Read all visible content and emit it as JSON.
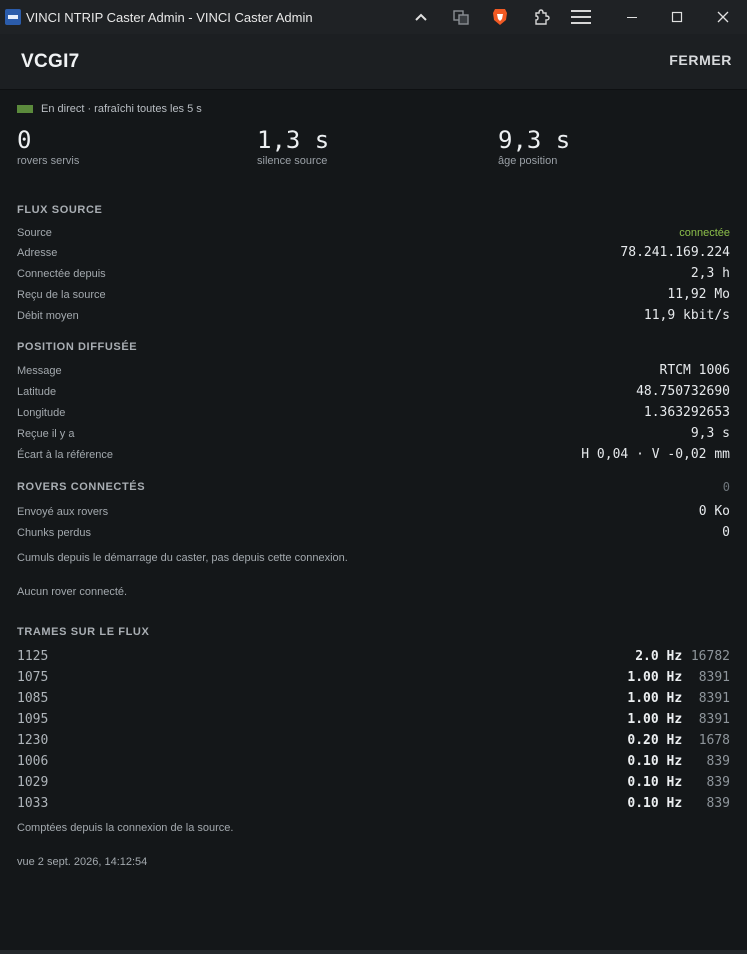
{
  "window": {
    "title": "VINCI NTRIP Caster Admin - VINCI Caster Admin",
    "icons": [
      "chevron-up-icon",
      "translate-icon",
      "brave-shield-icon",
      "extensions-icon",
      "menu-icon",
      "minimize-icon",
      "maximize-icon",
      "close-icon"
    ]
  },
  "header": {
    "name": "VCGI7",
    "close_label": "FERMER"
  },
  "live": {
    "text": "En direct · rafraîchi toutes les 5 s",
    "color": "#5b8a3c"
  },
  "stats": [
    {
      "value": "0",
      "label": "rovers servis"
    },
    {
      "value": "1,3 s",
      "label": "silence source"
    },
    {
      "value": "9,3 s",
      "label": "âge position"
    }
  ],
  "source_flow": {
    "title": "FLUX SOURCE",
    "rows": [
      {
        "k": "Source",
        "v": "connectée"
      },
      {
        "k": "Adresse",
        "v": "78.241.169.224"
      },
      {
        "k": "Connectée depuis",
        "v": "2,3 h"
      },
      {
        "k": "Reçu de la source",
        "v": "11,92 Mo"
      },
      {
        "k": "Débit moyen",
        "v": "11,9 kbit/s"
      }
    ]
  },
  "position": {
    "title": "POSITION DIFFUSÉE",
    "rows": [
      {
        "k": "Message",
        "v": "RTCM 1006"
      },
      {
        "k": "Latitude",
        "v": "48.750732690"
      },
      {
        "k": "Longitude",
        "v": "1.363292653"
      },
      {
        "k": "Reçue il y a",
        "v": "9,3 s"
      },
      {
        "k": "Écart à la référence",
        "v": "H 0,04 · V -0,02 mm"
      }
    ]
  },
  "rovers": {
    "title": "ROVERS CONNECTÉS",
    "count": "0",
    "rows": [
      {
        "k": "Envoyé aux rovers",
        "v": "0 Ko"
      },
      {
        "k": "Chunks perdus",
        "v": "0"
      }
    ],
    "note": "Cumuls depuis le démarrage du caster, pas depuis cette connexion.",
    "empty": "Aucun rover connecté."
  },
  "frames": {
    "title": "TRAMES SUR LE FLUX",
    "rows": [
      {
        "id": "1125",
        "hz": "2.0 Hz",
        "count": "16782"
      },
      {
        "id": "1075",
        "hz": "1.00 Hz",
        "count": "8391"
      },
      {
        "id": "1085",
        "hz": "1.00 Hz",
        "count": "8391"
      },
      {
        "id": "1095",
        "hz": "1.00 Hz",
        "count": "8391"
      },
      {
        "id": "1230",
        "hz": "0.20 Hz",
        "count": "1678"
      },
      {
        "id": "1006",
        "hz": "0.10 Hz",
        "count": "839"
      },
      {
        "id": "1029",
        "hz": "0.10 Hz",
        "count": "839"
      },
      {
        "id": "1033",
        "hz": "0.10 Hz",
        "count": "839"
      }
    ],
    "note": "Comptées depuis la connexion de la source."
  },
  "footer": {
    "seen": "vue 2 sept. 2026, 14:12:54"
  }
}
